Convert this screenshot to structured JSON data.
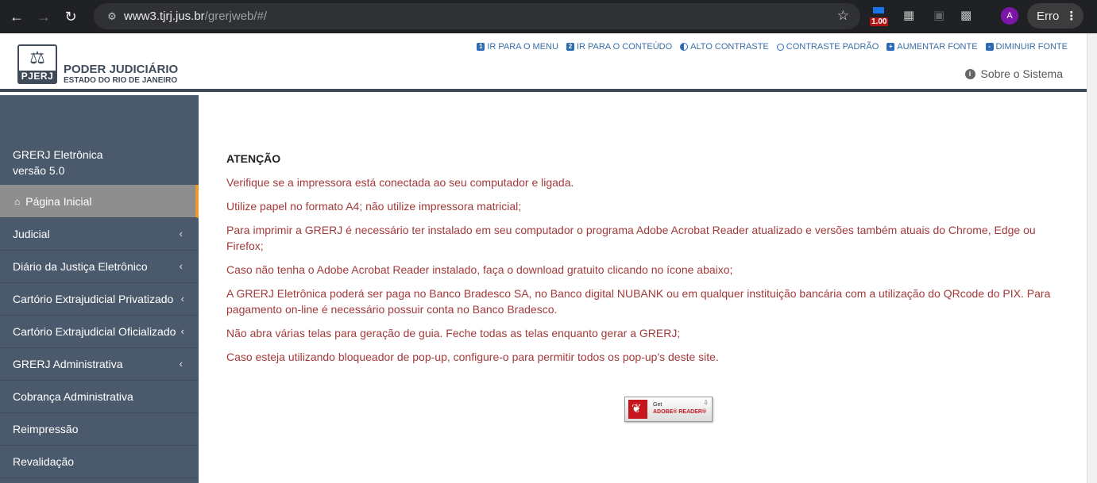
{
  "browser": {
    "url_host": "www3.tjrj.jus.br",
    "url_path": "/grerjweb/#/",
    "badge_count": "1.00",
    "profile_initial": "A",
    "error_label": "Erro"
  },
  "header": {
    "brand_title": "PODER JUDICIÁRIO",
    "brand_subtitle": "ESTADO DO RIO DE JANEIRO",
    "logo_text": "PJERJ",
    "accessibility": [
      {
        "icon": "1",
        "label": "IR PARA O MENU"
      },
      {
        "icon": "2",
        "label": "IR PARA O CONTEÚDO"
      },
      {
        "icon": "contrast",
        "label": "ALTO CONTRASTE"
      },
      {
        "icon": "ring",
        "label": "CONTRASTE PADRÃO"
      },
      {
        "icon": "+",
        "label": "AUMENTAR FONTE"
      },
      {
        "icon": "-",
        "label": "DIMINUIR FONTE"
      }
    ],
    "about_label": "Sobre o Sistema"
  },
  "sidebar": {
    "app_name": "GRERJ Eletrônica",
    "app_version": "versão 5.0",
    "items": [
      {
        "label": "Página Inicial",
        "active": true,
        "submenu": false
      },
      {
        "label": "Judicial",
        "submenu": true
      },
      {
        "label": "Diário da Justiça Eletrônico",
        "submenu": true
      },
      {
        "label": "Cartório Extrajudicial Privatizado",
        "submenu": true
      },
      {
        "label": "Cartório Extrajudicial Oficializado",
        "submenu": true
      },
      {
        "label": "GRERJ Administrativa",
        "submenu": true
      },
      {
        "label": "Cobrança Administrativa",
        "submenu": false
      },
      {
        "label": "Reimpressão",
        "submenu": false
      },
      {
        "label": "Revalidação",
        "submenu": false
      }
    ]
  },
  "content": {
    "title": "ATENÇÃO",
    "messages": [
      "Verifique se a impressora está conectada ao seu computador e ligada.",
      "Utilize papel no formato A4; não utilize impressora matricial;",
      "Para imprimir a GRERJ é necessário ter instalado em seu computador o programa Adobe Acrobat Reader atualizado e versões também atuais do Chrome, Edge ou Firefox;",
      "Caso não tenha o Adobe Acrobat Reader instalado, faça o download gratuito clicando no ícone abaixo;",
      "A GRERJ Eletrônica poderá ser paga no Banco Bradesco SA, no Banco digital NUBANK ou em qualquer instituição bancária com a utilização do QRcode do PIX. Para pagamento on-line é necessário possuir conta no Banco Bradesco.",
      "Não abra várias telas para geração de guia. Feche todas as telas enquanto gerar a GRERJ;",
      "Caso esteja utilizando bloqueador de pop-up, configure-o para permitir todos os pop-up's deste site."
    ],
    "adobe_get": "Get",
    "adobe_reader": "ADOBE® READER®"
  },
  "colors": {
    "sidebar_bg": "#4a5a6c",
    "active_item_bg": "#8e8e8e",
    "active_accent": "#e69a2d",
    "message_text": "#a33a3a",
    "link_blue": "#3a6ea5"
  }
}
